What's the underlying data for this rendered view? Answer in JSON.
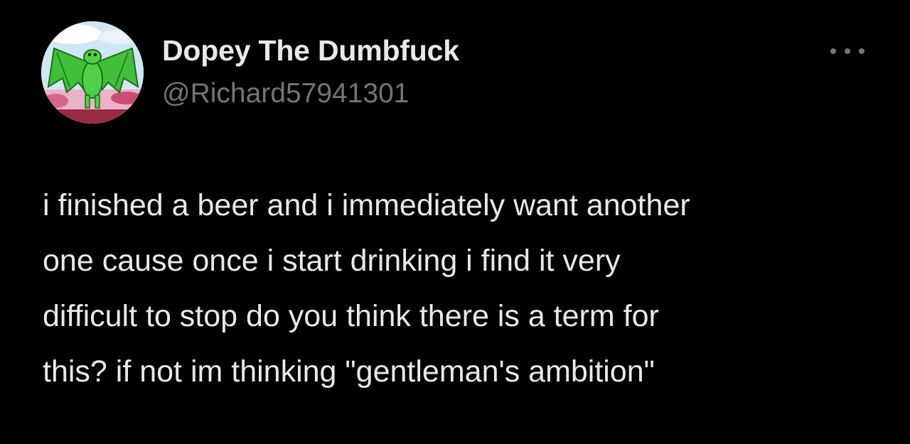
{
  "tweet": {
    "author": {
      "display_name": "Dopey The Dumbfuck",
      "handle": "@Richard57941301",
      "avatar_icon": "green-dragon-cartoon-avatar"
    },
    "menu_icon": "more-options-icon",
    "text_lines": [
      "i finished a beer and i immediately want another",
      "one cause once i start drinking i find it very",
      "difficult to stop do you think there is a term for",
      "this? if not im thinking \"gentleman's ambition\""
    ]
  },
  "colors": {
    "background": "#000000",
    "primary_text": "#e7e9ea",
    "secondary_text": "#71767b"
  }
}
